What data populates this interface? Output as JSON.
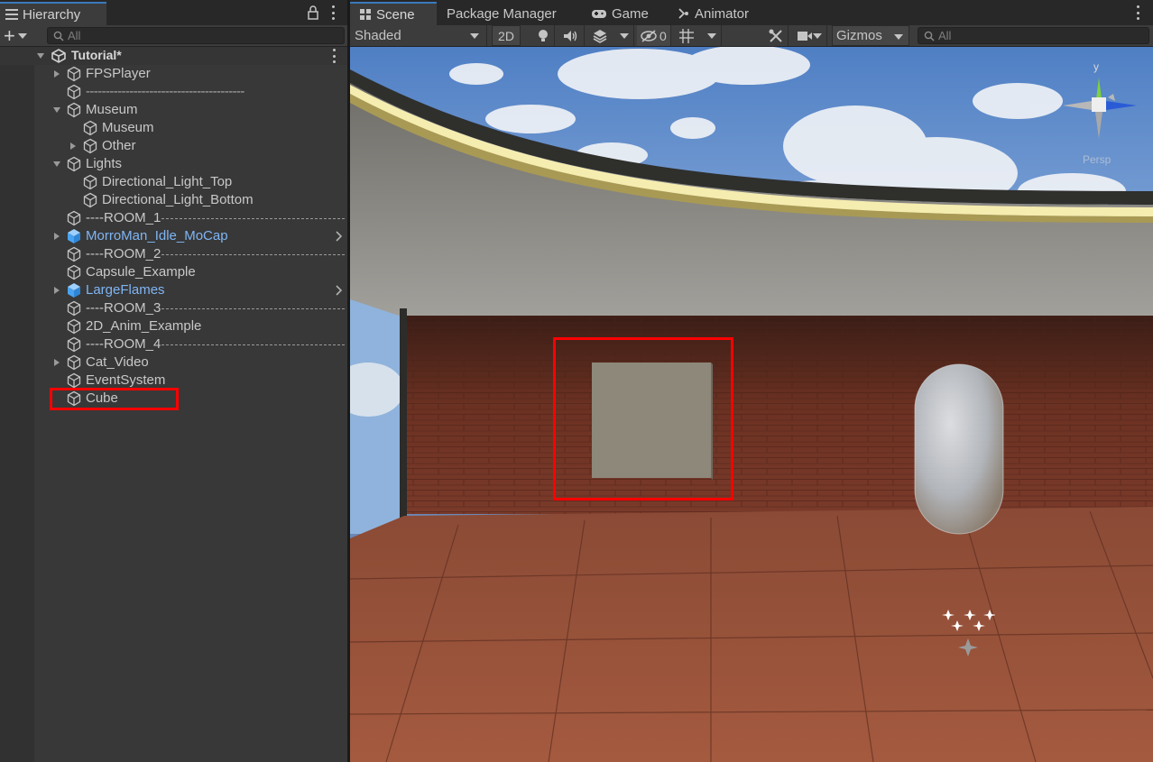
{
  "hierarchy": {
    "tab_label": "Hierarchy",
    "add_label": "+",
    "search_placeholder": "All",
    "scene_name": "Tutorial*",
    "items": [
      {
        "label": "FPSPlayer",
        "depth": 1,
        "expander": "collapsed",
        "prefab": false
      },
      {
        "label": "----------------------------------------",
        "depth": 1,
        "expander": "none",
        "prefab": false
      },
      {
        "label": "Museum",
        "depth": 1,
        "expander": "expanded",
        "prefab": false
      },
      {
        "label": "Museum",
        "depth": 2,
        "expander": "none",
        "prefab": false
      },
      {
        "label": "Other",
        "depth": 2,
        "expander": "collapsed",
        "prefab": false
      },
      {
        "label": "Lights",
        "depth": 1,
        "expander": "expanded",
        "prefab": false
      },
      {
        "label": "Directional_Light_Top",
        "depth": 2,
        "expander": "none",
        "prefab": false
      },
      {
        "label": "Directional_Light_Bottom",
        "depth": 2,
        "expander": "none",
        "prefab": false
      },
      {
        "label": "----ROOM_1",
        "depth": 1,
        "expander": "none",
        "prefab": false,
        "dashed": true
      },
      {
        "label": "MorroMan_Idle_MoCap",
        "depth": 1,
        "expander": "collapsed",
        "prefab": true
      },
      {
        "label": "----ROOM_2",
        "depth": 1,
        "expander": "none",
        "prefab": false,
        "dashed": true
      },
      {
        "label": "Capsule_Example",
        "depth": 1,
        "expander": "none",
        "prefab": false
      },
      {
        "label": "LargeFlames",
        "depth": 1,
        "expander": "collapsed",
        "prefab": true
      },
      {
        "label": "----ROOM_3",
        "depth": 1,
        "expander": "none",
        "prefab": false,
        "dashed": true
      },
      {
        "label": "2D_Anim_Example",
        "depth": 1,
        "expander": "none",
        "prefab": false
      },
      {
        "label": "----ROOM_4",
        "depth": 1,
        "expander": "none",
        "prefab": false,
        "dashed": true
      },
      {
        "label": "Cat_Video",
        "depth": 1,
        "expander": "collapsed",
        "prefab": false
      },
      {
        "label": "EventSystem",
        "depth": 1,
        "expander": "none",
        "prefab": false
      },
      {
        "label": "Cube",
        "depth": 1,
        "expander": "none",
        "prefab": false,
        "highlighted": true
      }
    ]
  },
  "scene_tabs": {
    "scene": "Scene",
    "package_manager": "Package Manager",
    "game": "Game",
    "animator": "Animator"
  },
  "scene_toolbar": {
    "draw_mode": "Shaded",
    "mode_2d": "2D",
    "hidden_count": "0",
    "gizmos": "Gizmos",
    "search_placeholder": "All"
  },
  "scene_view": {
    "projection_label": "Persp",
    "axis_y_label": "y",
    "highlight_color": "#ff0000"
  },
  "colors": {
    "accent": "#3a79bb",
    "prefab_text": "#7fb5f4",
    "panel_bg": "#383838"
  }
}
